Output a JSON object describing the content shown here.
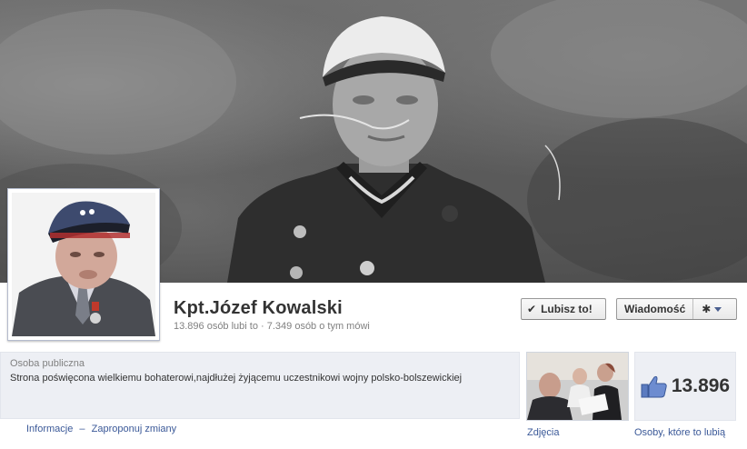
{
  "page": {
    "name": "Kpt.Józef Kowalski",
    "stats": "13.896 osób lubi to · 7.349 osób o tym mówi"
  },
  "actions": {
    "like_label": "Lubisz to!",
    "message_label": "Wiadomość"
  },
  "about": {
    "category": "Osoba publiczna",
    "description": "Strona poświęcona wielkiemu bohaterowi,najdłużej żyjącemu uczestnikowi wojny polsko-bolszewickiej",
    "links": [
      "Informacje",
      "Zaproponuj zmiany"
    ],
    "separator": "–"
  },
  "tiles": {
    "photos_label": "Zdjęcia",
    "likes_count": "13.896",
    "likes_label": "Osoby, które to lubią"
  },
  "icons": {
    "like_check": "check-icon",
    "gear": "gear-icon",
    "dropdown": "caret-down-icon",
    "thumbs_up": "thumbs-up-icon"
  },
  "colors": {
    "link": "#3b5998",
    "panel": "#edeff4",
    "text": "#333333",
    "muted": "#808080"
  }
}
